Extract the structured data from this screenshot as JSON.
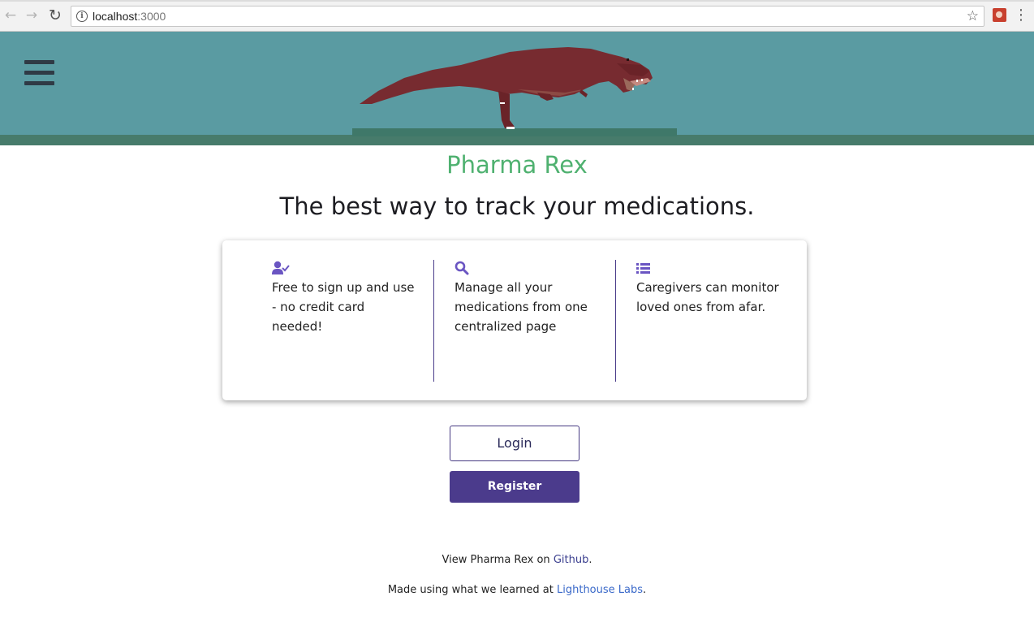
{
  "browser": {
    "url_host": "localhost",
    "url_port": ":3000"
  },
  "header": {
    "menu_icon": "hamburger-menu-icon",
    "mascot": "pixel-trex"
  },
  "main": {
    "title": "Pharma Rex",
    "tagline": "The best way to track your medications."
  },
  "features": [
    {
      "icon": "user-check-icon",
      "text": "Free to sign up and use - no credit card needed!"
    },
    {
      "icon": "search-icon",
      "text": "Manage all your medications from one centralized page"
    },
    {
      "icon": "list-icon",
      "text": "Caregivers can monitor loved ones from afar."
    }
  ],
  "buttons": {
    "login_label": "Login",
    "register_label": "Register"
  },
  "footer": {
    "github_prefix": "View Pharma Rex on ",
    "github_link": "Github",
    "github_suffix": ".",
    "labs_prefix": "Made using what we learned at ",
    "labs_link": "Lighthouse Labs",
    "labs_suffix": "."
  },
  "colors": {
    "banner": "#5a9ba2",
    "brand_green": "#4fb170",
    "accent_purple": "#4b3b8c",
    "icon_purple": "#6a55c2",
    "link_blue": "#3a69c9"
  }
}
